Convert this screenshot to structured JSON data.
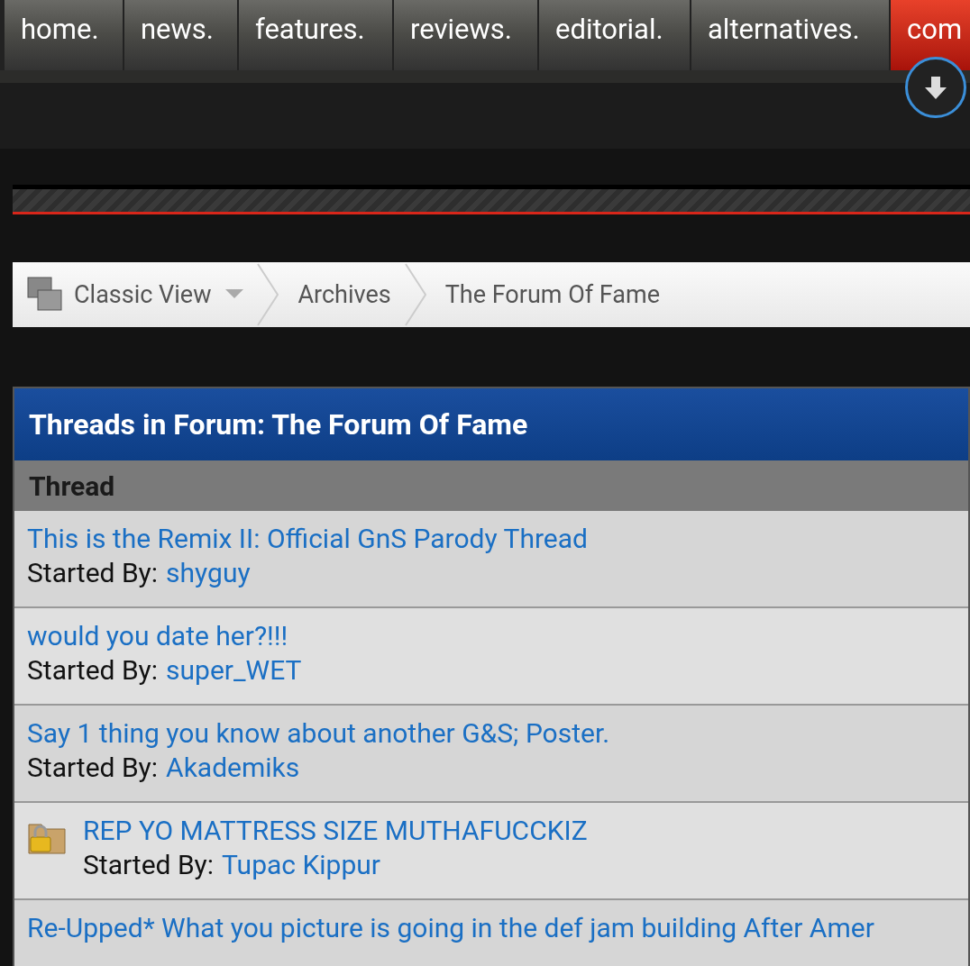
{
  "nav_tabs": [
    {
      "label": "home.",
      "selected": false
    },
    {
      "label": "news.",
      "selected": false
    },
    {
      "label": "features.",
      "selected": false
    },
    {
      "label": "reviews.",
      "selected": false
    },
    {
      "label": "editorial.",
      "selected": false
    },
    {
      "label": "alternatives.",
      "selected": false
    },
    {
      "label": "com",
      "selected": true
    }
  ],
  "breadcrumb": {
    "view": "Classic View",
    "items": [
      "Archives",
      "The Forum Of Fame"
    ]
  },
  "forum": {
    "title": "Threads in Forum: The Forum Of Fame",
    "column": "Thread",
    "threads": [
      {
        "title": "This is the Remix II: Official GnS Parody Thread",
        "started_label": "Started By:",
        "author": "shyguy",
        "locked": false
      },
      {
        "title": "would you date her?!!!",
        "started_label": "Started By:",
        "author": "super_WET",
        "locked": false
      },
      {
        "title": "Say 1 thing you know about another G&S; Poster.",
        "started_label": "Started By:",
        "author": "Akademiks",
        "locked": false
      },
      {
        "title": "REP YO MATTRESS SIZE MUTHAFUCCKIZ",
        "started_label": "Started By:",
        "author": "Tupac Kippur",
        "locked": true
      },
      {
        "title": "Re-Upped* What you picture is going in the def jam building After Amer",
        "locked": false
      }
    ]
  }
}
